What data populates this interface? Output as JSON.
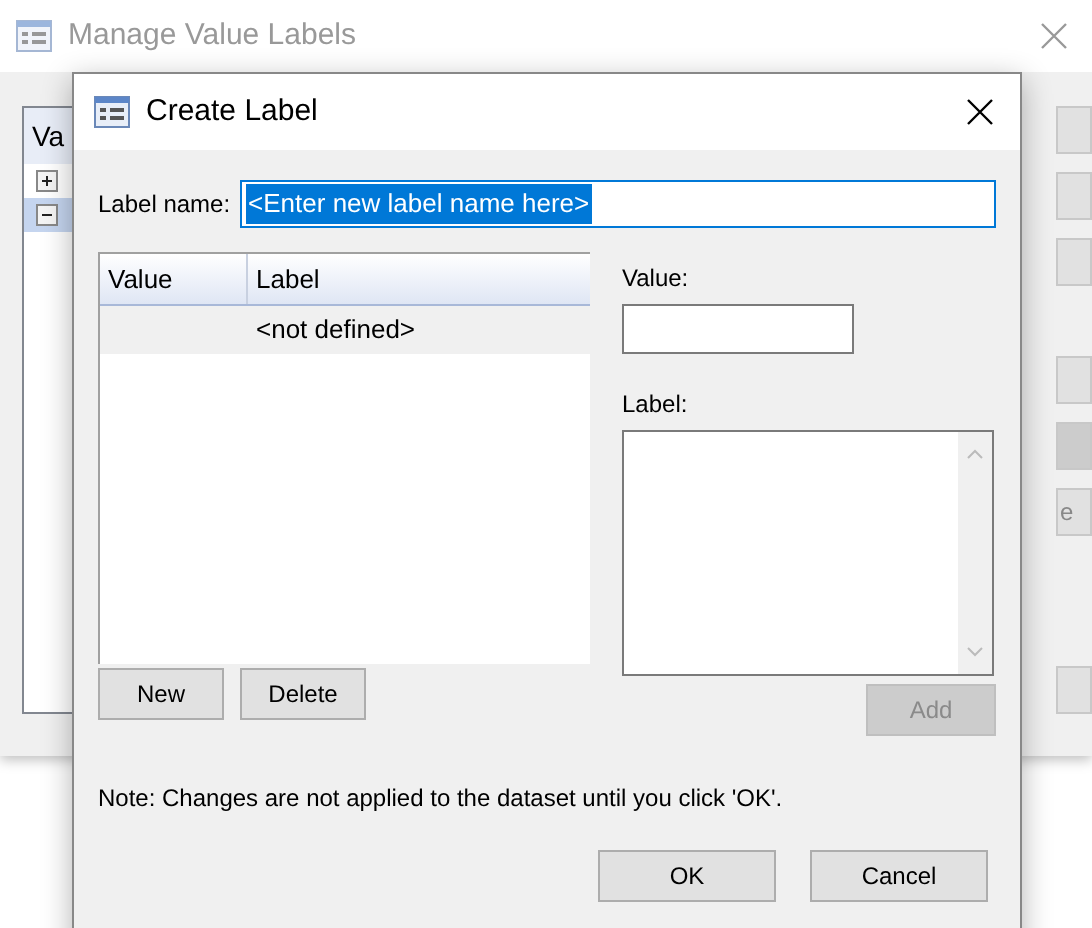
{
  "background_window": {
    "title": "Manage Value Labels",
    "list_header": "Va",
    "tree_rows": [
      {
        "expanded": false,
        "selected": false
      },
      {
        "expanded": true,
        "selected": true
      }
    ],
    "side_buttons": [
      {
        "kind": "plain"
      },
      {
        "kind": "plain"
      },
      {
        "kind": "plain"
      },
      {
        "kind": "plain"
      },
      {
        "kind": "dark"
      },
      {
        "kind": "text",
        "label": "e"
      },
      {
        "kind": "plain"
      }
    ]
  },
  "dialog": {
    "title": "Create Label",
    "label_name": {
      "label": "Label name:",
      "value": "<Enter new label name here>",
      "selected": true
    },
    "table": {
      "columns": [
        "Value",
        "Label"
      ],
      "rows": [
        {
          "label": "<not defined>"
        }
      ]
    },
    "value_field": {
      "label": "Value:"
    },
    "label_field": {
      "label": "Label:"
    },
    "list_buttons": [
      {
        "label": "New"
      },
      {
        "label": "Delete"
      }
    ],
    "add_button": {
      "label": "Add",
      "disabled": true
    },
    "note": "Note: Changes are not applied to the dataset until you click 'OK'.",
    "footer_buttons": [
      {
        "label": "OK"
      },
      {
        "label": "Cancel"
      }
    ]
  }
}
